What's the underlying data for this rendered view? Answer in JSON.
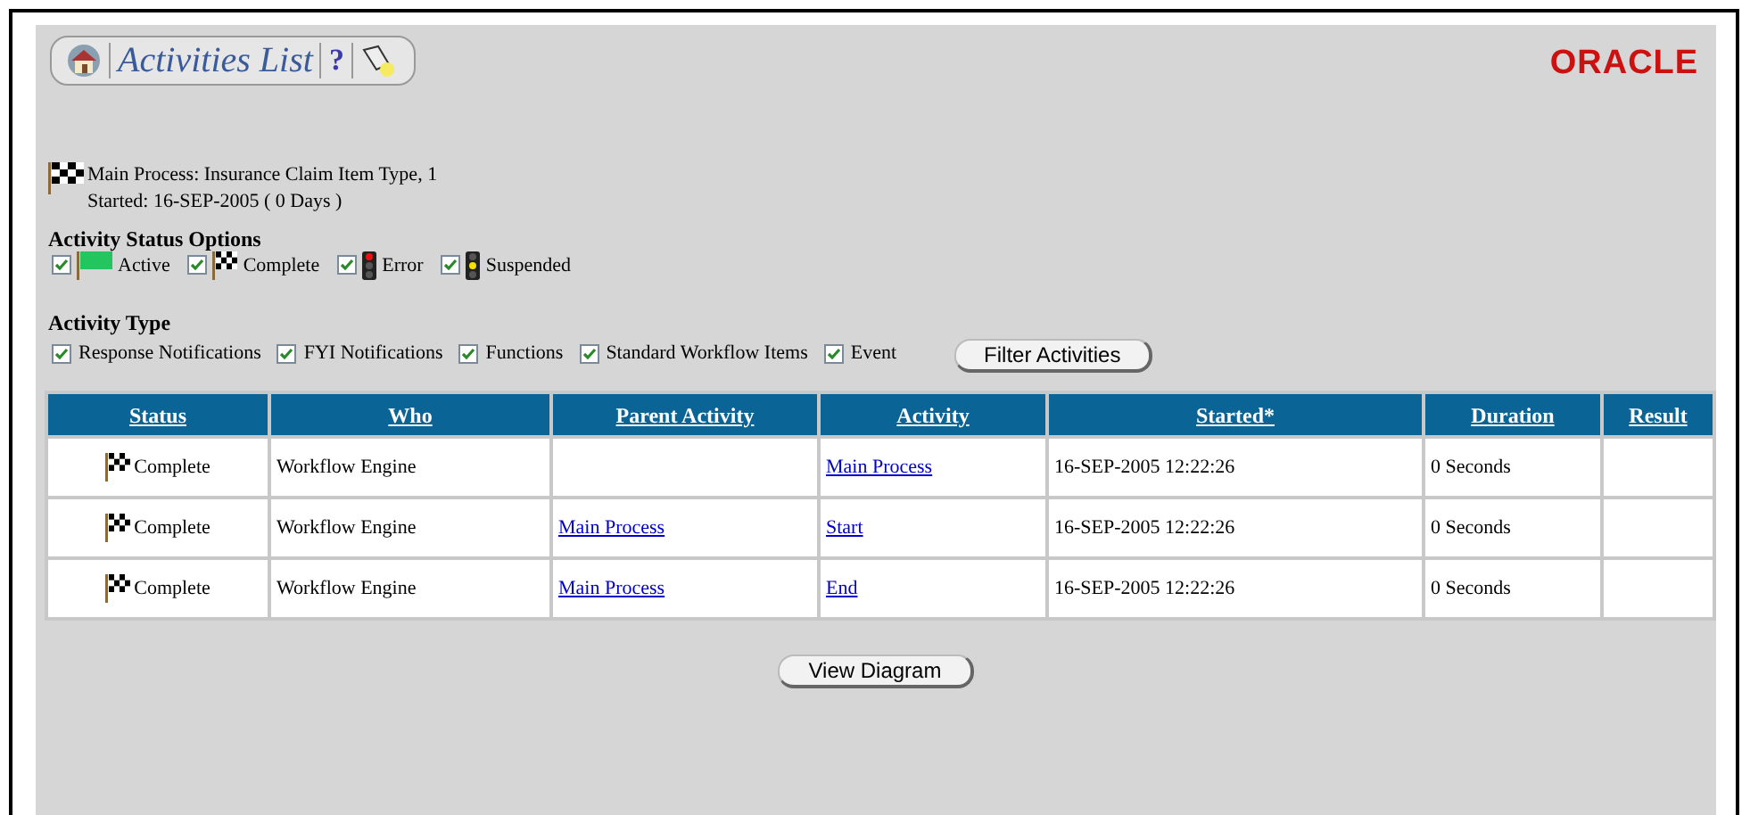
{
  "header": {
    "title": "Activities List",
    "help": "?",
    "logo": "ORACLE"
  },
  "process": {
    "name": "Main Process: Insurance Claim Item Type, 1",
    "started": "Started: 16-SEP-2005 ( 0 Days )"
  },
  "status_options": {
    "title": "Activity Status Options",
    "items": [
      {
        "label": "Active",
        "kind": "active",
        "checked": true
      },
      {
        "label": "Complete",
        "kind": "complete",
        "checked": true
      },
      {
        "label": "Error",
        "kind": "error",
        "checked": true
      },
      {
        "label": "Suspended",
        "kind": "suspended",
        "checked": true
      }
    ]
  },
  "activity_type": {
    "title": "Activity Type",
    "items": [
      {
        "label": "Response Notifications",
        "checked": true
      },
      {
        "label": "FYI Notifications",
        "checked": true
      },
      {
        "label": "Functions",
        "checked": true
      },
      {
        "label": "Standard Workflow Items",
        "checked": true
      },
      {
        "label": "Event",
        "checked": true
      }
    ],
    "button": "Filter Activities"
  },
  "table": {
    "columns": [
      "Status",
      "Who",
      "Parent Activity",
      "Activity",
      "Started*",
      "Duration",
      "Result"
    ],
    "rows": [
      {
        "status": {
          "kind": "complete",
          "label": "Complete"
        },
        "who": "Workflow Engine",
        "activity": "Main Process",
        "started": "16-SEP-2005 12:22:26",
        "duration": "0 Seconds"
      },
      {
        "status": {
          "kind": "complete",
          "label": "Complete"
        },
        "who": "Workflow Engine",
        "parent_activity": "Main Process",
        "activity": "Start",
        "started": "16-SEP-2005 12:22:26",
        "duration": "0 Seconds"
      },
      {
        "status": {
          "kind": "complete",
          "label": "Complete"
        },
        "who": "Workflow Engine",
        "parent_activity": "Main Process",
        "activity": "End",
        "started": "16-SEP-2005 12:22:26",
        "duration": "0 Seconds"
      }
    ]
  },
  "footer_button": "View Diagram"
}
